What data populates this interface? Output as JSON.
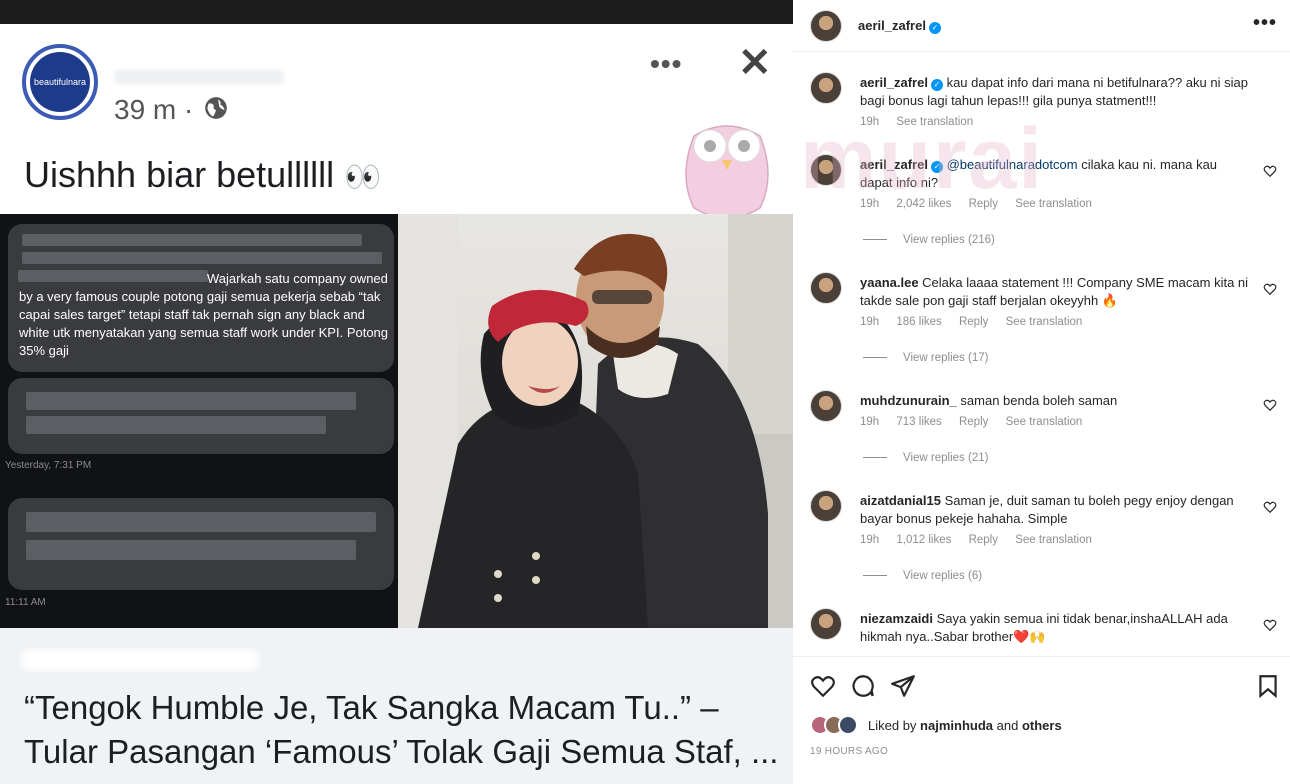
{
  "facebook_post": {
    "time": "39 m",
    "dot": "·",
    "avatar_text": "beautifulnara",
    "caption": "Uishhh biar betullllll",
    "caption_emoji": "👀",
    "chat": {
      "message": "Wajarkah satu company owned by a very famous couple potong gaji semua pekerja sebab “tak capai sales target” tetapi staff tak pernah sign any black and white utk menyatakan yang semua staff work under KPI. Potong 35% gaji",
      "timestamp_1": "Yesterday, 7:31 PM",
      "timestamp_2": "11:11 AM"
    },
    "link_title": "“Tengok Humble Je, Tak Sangka Macam Tu..” – Tular Pasangan ‘Famous’ Tolak Gaji Semua Staf, ..."
  },
  "instagram": {
    "owner": "aeril_zafrel",
    "comments": [
      {
        "user": "aeril_zafrel",
        "verified": true,
        "text": "kau dapat info dari mana ni betifulnara?? aku ni siap bagi bonus lagi tahun lepas!!! gila punya statment!!!",
        "time": "19h",
        "likes": "",
        "reply": "",
        "translate": "See translation",
        "replies": ""
      },
      {
        "user": "aeril_zafrel",
        "verified": true,
        "mention": "@beautifulnaradotcom",
        "text": "cilaka kau ni. mana kau dapat info ni?",
        "time": "19h",
        "likes": "2,042 likes",
        "reply": "Reply",
        "translate": "See translation",
        "replies": "View replies (216)"
      },
      {
        "user": "yaana.lee",
        "verified": false,
        "text": "Celaka laaaa statement !!! Company SME macam kita ni takde sale pon gaji staff berjalan okeyyhh 🔥",
        "time": "19h",
        "likes": "186 likes",
        "reply": "Reply",
        "translate": "See translation",
        "replies": "View replies (17)"
      },
      {
        "user": "muhdzunurain_",
        "verified": false,
        "text": "saman benda boleh saman",
        "time": "19h",
        "likes": "713 likes",
        "reply": "Reply",
        "translate": "See translation",
        "replies": "View replies (21)"
      },
      {
        "user": "aizatdanial15",
        "verified": false,
        "text": "Saman je, duit saman tu boleh pegy enjoy dengan bayar bonus pekeje hahaha. Simple",
        "time": "19h",
        "likes": "1,012 likes",
        "reply": "Reply",
        "translate": "See translation",
        "replies": "View replies (6)"
      },
      {
        "user": "niezamzaidi",
        "verified": false,
        "text": "Saya yakin semua ini tidak benar,inshaALLAH ada hikmah nya..Sabar brother❤️🙌",
        "time": "",
        "likes": "",
        "reply": "",
        "translate": "",
        "replies": ""
      }
    ],
    "liked_by_prefix": "Liked by",
    "liked_by_user": "najminhuda",
    "liked_by_and": "and",
    "liked_by_others": "others",
    "posted_ago": "19 HOURS AGO",
    "more": "•••",
    "verified_mark": "✓"
  },
  "watermark": "murai",
  "colors": {
    "verified": "#0095f6",
    "avatar_ring": "#3b5bb5",
    "beret": "#c0283a"
  }
}
